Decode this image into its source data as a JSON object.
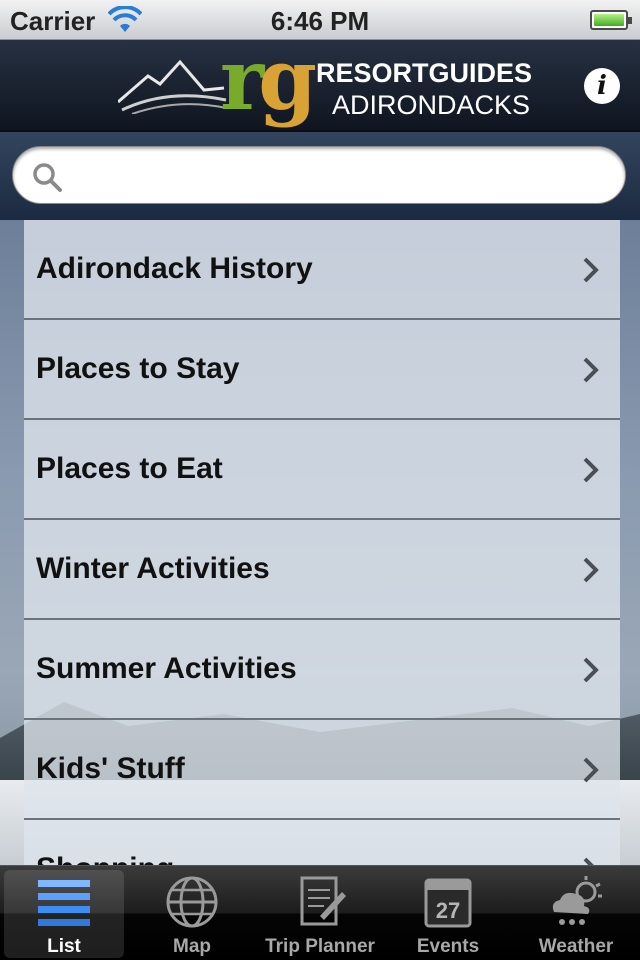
{
  "status": {
    "carrier": "Carrier",
    "time": "6:46 PM"
  },
  "header": {
    "logo_letters": "rg",
    "logo_line1": "RESORTGUIDES",
    "logo_line2": "ADIRONDACKS",
    "info_label": "i"
  },
  "search": {
    "placeholder": "",
    "value": ""
  },
  "list": {
    "items": [
      {
        "label": "Adirondack History"
      },
      {
        "label": "Places to Stay"
      },
      {
        "label": "Places to Eat"
      },
      {
        "label": "Winter Activities"
      },
      {
        "label": "Summer Activities"
      },
      {
        "label": "Kids' Stuff"
      },
      {
        "label": "Shopping"
      }
    ]
  },
  "tabs": [
    {
      "label": "List",
      "icon": "list-icon",
      "active": true
    },
    {
      "label": "Map",
      "icon": "globe-icon",
      "active": false
    },
    {
      "label": "Trip Planner",
      "icon": "notepad-icon",
      "active": false
    },
    {
      "label": "Events",
      "icon": "calendar-icon",
      "calendar_day": "27",
      "active": false
    },
    {
      "label": "Weather",
      "icon": "weather-icon",
      "active": false
    }
  ],
  "colors": {
    "logo_r": "#7aaa2c",
    "logo_g": "#d9a235",
    "navbar": "#1b2433"
  }
}
